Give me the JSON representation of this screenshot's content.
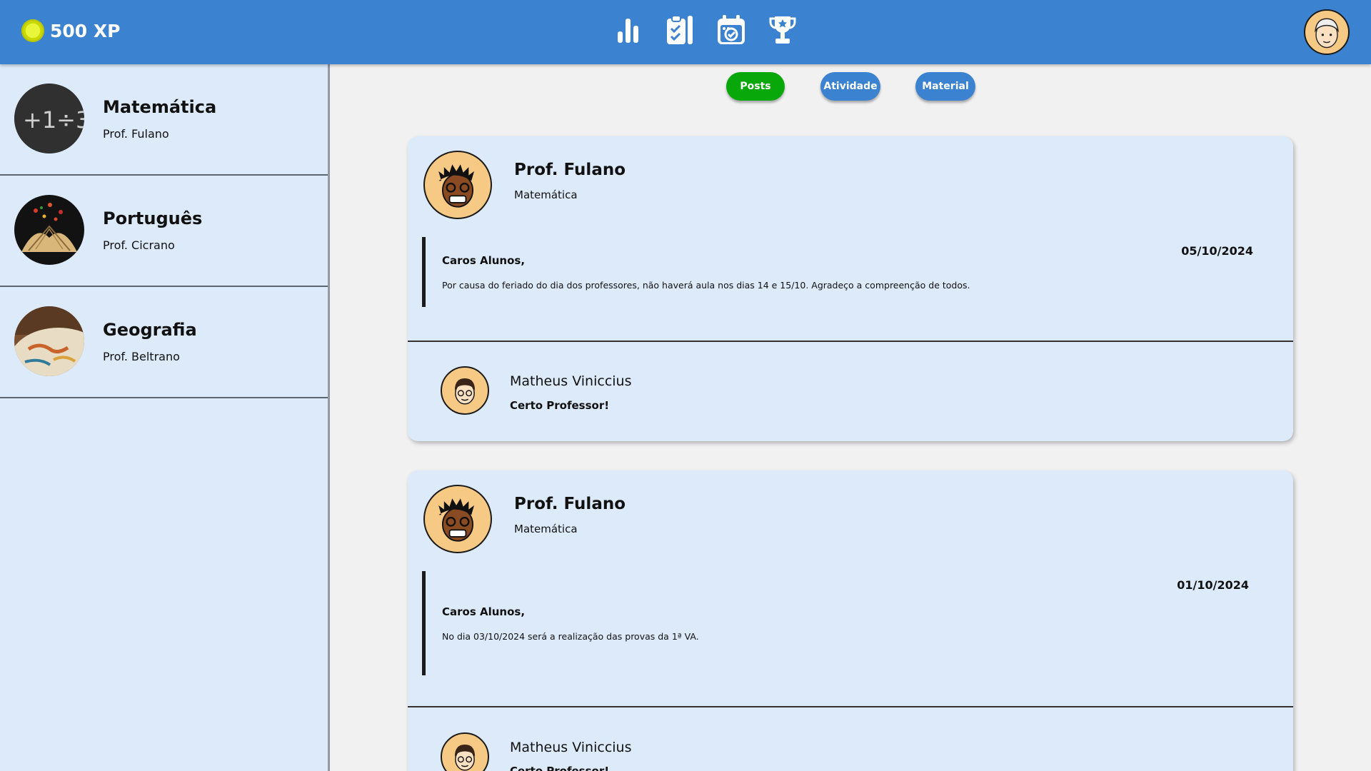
{
  "header": {
    "xp_label": "500 XP",
    "nav_icons": [
      "bar-chart-icon",
      "clipboard-check-icon",
      "calendar-icon",
      "trophy-icon"
    ],
    "colors": {
      "bar": "#3b82d0",
      "coin": "#e8f53a"
    }
  },
  "sidebar": {
    "courses": [
      {
        "name": "Matemática",
        "professor": "Prof. Fulano",
        "image": "chalkboard-math"
      },
      {
        "name": "Português",
        "professor": "Prof. Cicrano",
        "image": "open-book"
      },
      {
        "name": "Geografia",
        "professor": "Prof. Beltrano",
        "image": "globe"
      }
    ]
  },
  "tabs": {
    "posts": "Posts",
    "atividade": "Atividade",
    "material": "Material",
    "active": "Posts",
    "active_color": "#08a80a"
  },
  "posts": [
    {
      "author": "Prof. Fulano",
      "subject": "Matemática",
      "date": "05/10/2024",
      "greeting": "Caros Alunos,",
      "body": "Por causa do feriado do dia dos professores, não haverá aula nos dias 14 e 15/10. Agradeço a compreenção de todos.",
      "comment": {
        "author": "Matheus Viniccius",
        "text": "Certo Professor!"
      }
    },
    {
      "author": "Prof. Fulano",
      "subject": "Matemática",
      "date": "01/10/2024",
      "greeting": "Caros Alunos,",
      "body": "No dia 03/10/2024 será a realização das provas da 1ª VA.",
      "comment": {
        "author": "Matheus Viniccius",
        "text": "Certo Professor!"
      }
    }
  ]
}
